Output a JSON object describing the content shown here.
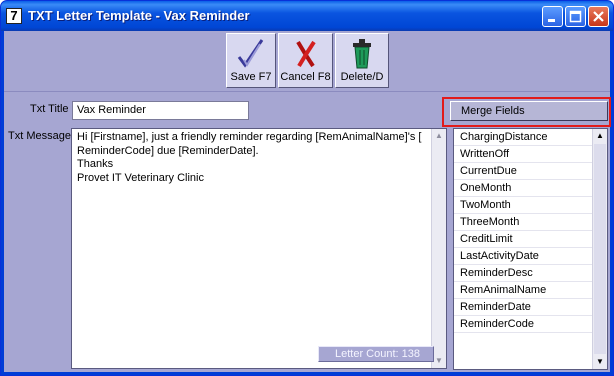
{
  "window": {
    "app_icon": "7",
    "title": "TXT Letter Template - Vax Reminder"
  },
  "toolbar": {
    "save_label": "Save F7",
    "cancel_label": "Cancel F8",
    "delete_label": "Delete/D"
  },
  "form": {
    "title_label": "Txt Title",
    "title_value": "Vax Reminder",
    "message_label": "Txt Message",
    "message_value": "Hi [Firstname], just a friendly reminder regarding [RemAnimalName]'s [\nReminderCode] due [ReminderDate].\nThanks\nProvet IT Veterinary Clinic",
    "letter_count": "Letter Count: 138"
  },
  "merge_fields": {
    "button_label": "Merge Fields",
    "items": [
      "ChargingDistance",
      "WrittenOff",
      "CurrentDue",
      "OneMonth",
      "TwoMonth",
      "ThreeMonth",
      "CreditLimit",
      "LastActivityDate",
      "ReminderDesc",
      "RemAnimalName",
      "ReminderDate",
      "ReminderCode"
    ]
  },
  "colors": {
    "title_bar": "#0046d5",
    "client_bg": "#a6a6d2",
    "highlight": "#e21b1b"
  },
  "icons": {
    "save": "pencil-check-icon",
    "cancel": "red-x-icon",
    "delete": "trash-can-icon"
  }
}
